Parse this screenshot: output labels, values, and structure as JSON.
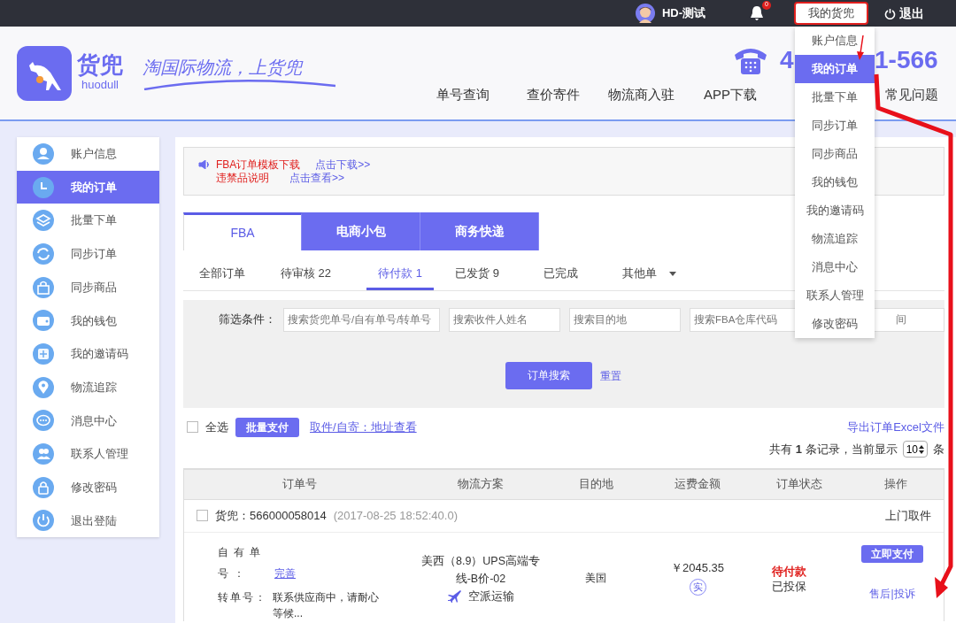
{
  "top_bar": {
    "user_name": "HD-测试",
    "notification_count": "0",
    "account_menu": "我的货兜",
    "logout": "退出"
  },
  "header": {
    "logo_text": "货兜",
    "logo_subtext": "huodull",
    "slogan": "淘国际物流，上货兜",
    "phone_parts": [
      "4",
      "1-566"
    ],
    "nav": [
      "单号查询",
      "查价寄件",
      "物流商入驻",
      "APP下载",
      "常见问题"
    ]
  },
  "account_dropdown": [
    {
      "label": "账户信息",
      "selected": false
    },
    {
      "label": "我的订单",
      "selected": true
    },
    {
      "label": "批量下单",
      "selected": false
    },
    {
      "label": "同步订单",
      "selected": false
    },
    {
      "label": "同步商品",
      "selected": false
    },
    {
      "label": "我的钱包",
      "selected": false
    },
    {
      "label": "我的邀请码",
      "selected": false
    },
    {
      "label": "物流追踪",
      "selected": false
    },
    {
      "label": "消息中心",
      "selected": false
    },
    {
      "label": "联系人管理",
      "selected": false
    },
    {
      "label": "修改密码",
      "selected": false
    }
  ],
  "sidebar": [
    {
      "label": "账户信息",
      "selected": false
    },
    {
      "label": "我的订单",
      "selected": true
    },
    {
      "label": "批量下单",
      "selected": false
    },
    {
      "label": "同步订单",
      "selected": false
    },
    {
      "label": "同步商品",
      "selected": false
    },
    {
      "label": "我的钱包",
      "selected": false
    },
    {
      "label": "我的邀请码",
      "selected": false
    },
    {
      "label": "物流追踪",
      "selected": false
    },
    {
      "label": "消息中心",
      "selected": false
    },
    {
      "label": "联系人管理",
      "selected": false
    },
    {
      "label": "修改密码",
      "selected": false
    },
    {
      "label": "退出登陆",
      "selected": false
    }
  ],
  "notice": [
    {
      "text": "FBA订单模板下载",
      "link": "点击下载>>"
    },
    {
      "text": "违禁品说明",
      "link": "点击查看>>"
    }
  ],
  "service_tabs": [
    {
      "label": "FBA",
      "selected": true
    },
    {
      "label": "电商小包",
      "selected": false
    },
    {
      "label": "商务快递",
      "selected": false
    }
  ],
  "status_tabs": [
    {
      "label": "全部订单",
      "kind": "tab",
      "selected": false
    },
    {
      "label": "待审核 22",
      "kind": "tab",
      "selected": false
    },
    {
      "label": "待付款 1",
      "kind": "tab",
      "selected": true
    },
    {
      "label": "已发货 9",
      "kind": "tab",
      "selected": false
    },
    {
      "label": "已完成",
      "kind": "tab",
      "selected": false
    },
    {
      "label": "其他单",
      "kind": "dropdown",
      "selected": false
    }
  ],
  "filter": {
    "label": "筛选条件：",
    "fields": [
      {
        "placeholder": "搜索货兜单号/自有单号/转单号"
      },
      {
        "placeholder": "搜索收件人姓名"
      },
      {
        "placeholder": "搜索目的地"
      },
      {
        "placeholder": "搜索FBA仓库代码"
      },
      {
        "placeholder": "间"
      }
    ],
    "search_button": "订单搜索",
    "reset": "重置"
  },
  "toolbar": {
    "select_all": "全选",
    "select_all_checked": false,
    "batch_pay": "批量支付",
    "address_link": "取件/自寄：地址查看",
    "export": "导出订单Excel文件",
    "records": "共有 **1** 条记录，当前显示",
    "page_size": "10",
    "page_unit": "条"
  },
  "table": {
    "columns": [
      "订单号",
      "物流方案",
      "目的地",
      "运费金额",
      "订单状态",
      "操作"
    ],
    "orders": [
      {
        "checked": false,
        "order_no": "货兜：566000058014",
        "time": "(2017-08-25 18:52:40.0)",
        "pickup": "上门取件",
        "own_no_label": "自有单号：",
        "own_no_link": "完善",
        "transfer_label": "转单号：",
        "transfer_value": "联系供应商中，请耐心等候...",
        "plan": "美西（8.9）UPS高端专线-B价-02",
        "transport": "空派运输",
        "destination": "美国",
        "amount": "￥2045.35",
        "amount_tag": "实",
        "status": "待付款",
        "insured": "已投保",
        "pay_button": "立即支付",
        "complaint": "售后|投诉"
      }
    ]
  }
}
